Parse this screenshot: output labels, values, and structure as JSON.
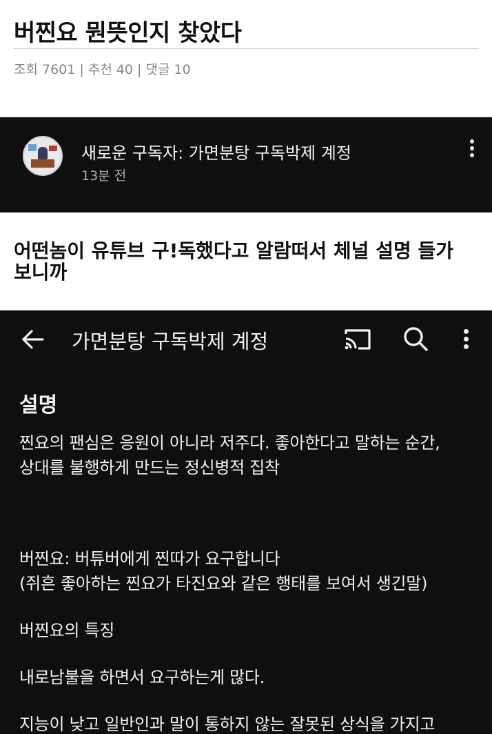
{
  "post": {
    "title": "버찐요 뭔뜻인지 찾았다",
    "meta": "조회 7601 | 추천 40 | 댓글 10"
  },
  "notification": {
    "title": "새로운 구독자: 가면분탕 구독박제 계정",
    "time": "13분 전"
  },
  "caption": "어떤놈이 유튜브 구!독했다고 알람떠서 체널 설명 들가보니까",
  "channel_page": {
    "title": "가면분탕 구독박제 계정",
    "description_heading": "설명",
    "description_lines": [
      "찐요의 팬심은 응원이 아니라 저주다. 좋아한다고 말하는 순간,",
      "상대를 불행하게 만드는 정신병적 집착",
      "버찐요: 버튜버에게 찐따가 요구합니다",
      "(쥐흔 좋아하는 찐요가 타진요와 같은 행태를 보여서 생긴말)",
      "버찐요의 특징",
      "내로남불을 하면서 요구하는게 많다.",
      "지능이 낮고 일반인과 말이 통하지 않는 잘못된 상식을 가지고"
    ]
  },
  "icons": {
    "back": "arrow-left-icon",
    "cast": "cast-icon",
    "search": "search-icon",
    "more": "more-vertical-icon"
  },
  "colors": {
    "dark_bg": "#0f0f0f",
    "light_text": "#f1f1f1",
    "muted_text": "#aaaaaa"
  }
}
